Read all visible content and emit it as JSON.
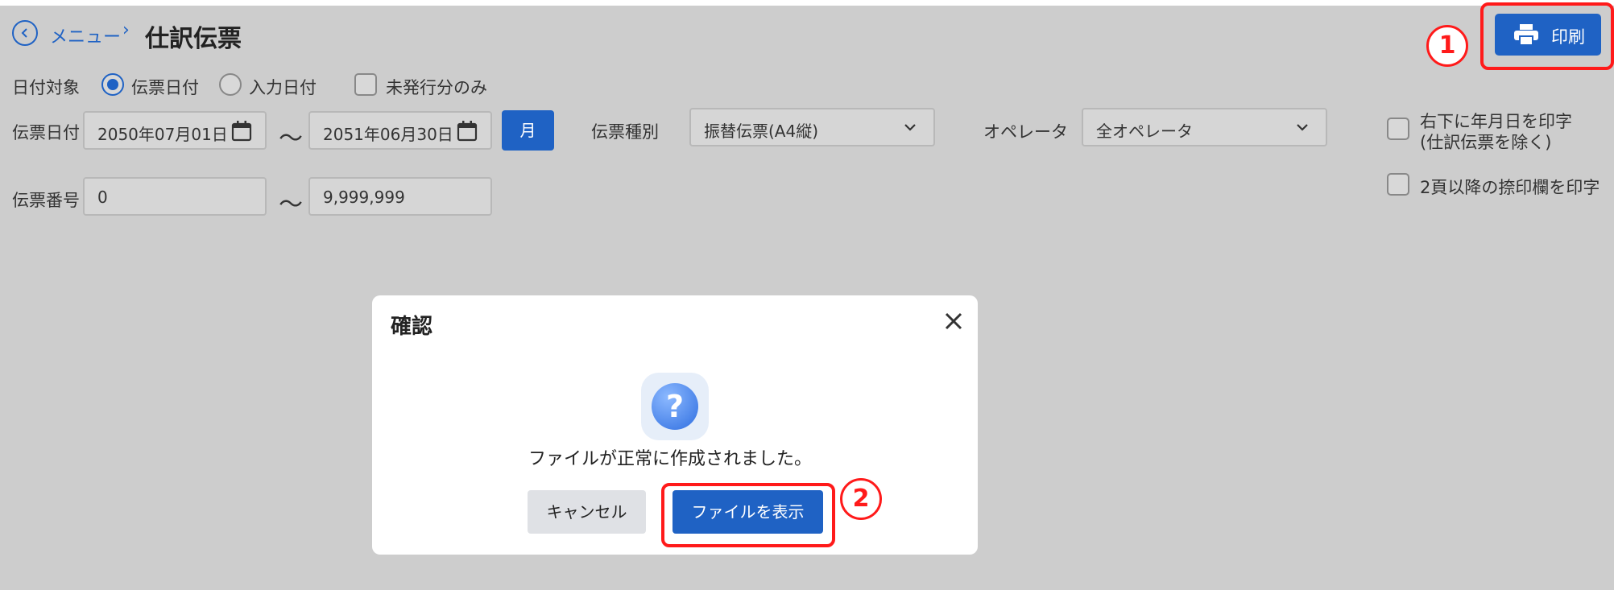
{
  "header": {
    "breadcrumb_link": "メニュー",
    "breadcrumb_separator": "›",
    "page_title": "仕訳伝票",
    "print_label": "印刷"
  },
  "annotations": {
    "badge_1": "1",
    "badge_2": "2",
    "highlight_color": "#ff1a1a"
  },
  "filters": {
    "date_target_label": "日付対象",
    "date_target_options": [
      {
        "label": "伝票日付",
        "selected": true
      },
      {
        "label": "入力日付",
        "selected": false
      }
    ],
    "unissued_only_label": "未発行分のみ",
    "voucher_date_label": "伝票日付",
    "date_from": "2050年07月01日",
    "date_to": "2051年06月30日",
    "range_separator": "〜",
    "month_button": "月",
    "voucher_type_label": "伝票種別",
    "voucher_type_value": "振替伝票(A4縦)",
    "operator_label": "オペレータ",
    "operator_value": "全オペレータ",
    "print_date_option_line1": "右下に年月日を印字",
    "print_date_option_line2": "(仕訳伝票を除く)",
    "seal_option_label": "2頁以降の捺印欄を印字",
    "voucher_number_label": "伝票番号",
    "number_from": "0",
    "number_to": "9,999,999"
  },
  "dialog": {
    "title": "確認",
    "icon": "question-icon",
    "message": "ファイルが正常に作成されました。",
    "cancel_label": "キャンセル",
    "show_file_label": "ファイルを表示"
  },
  "colors": {
    "accent": "#1f62c4",
    "overlay": "#cdcdcd"
  }
}
